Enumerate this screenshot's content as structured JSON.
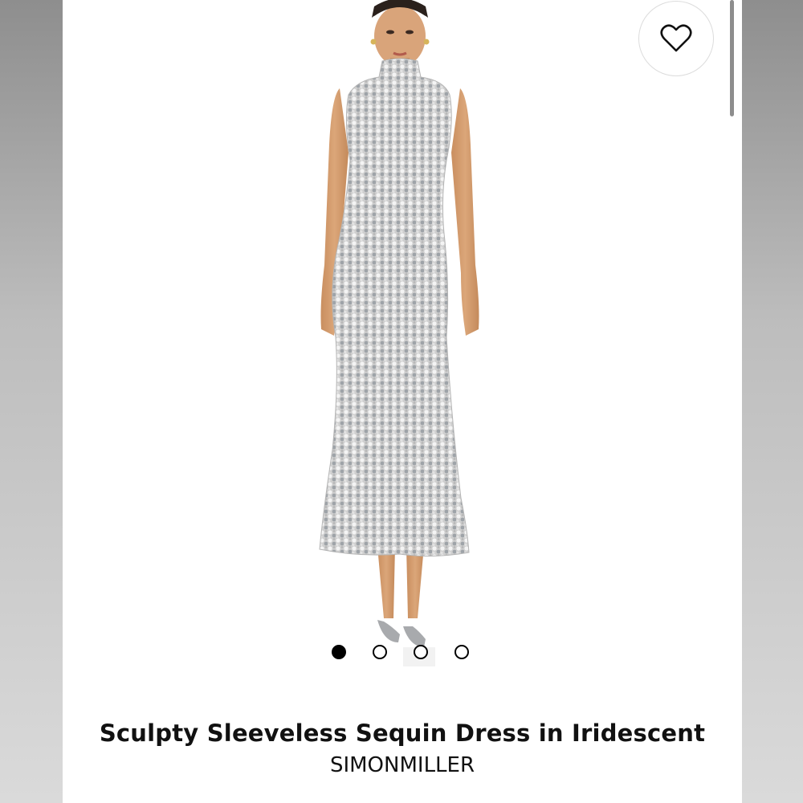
{
  "product": {
    "title": "Sculpty Sleeveless Sequin Dress in Iridescent",
    "brand": "SIMONMILLER"
  },
  "gallery": {
    "image_count": 4,
    "active_index": 0
  },
  "favorite": {
    "icon": "heart-outline-icon",
    "active": false
  },
  "colors": {
    "background": "#ffffff",
    "text": "#111111",
    "dot_active": "#000000",
    "sequin": "#c9c9c9"
  }
}
